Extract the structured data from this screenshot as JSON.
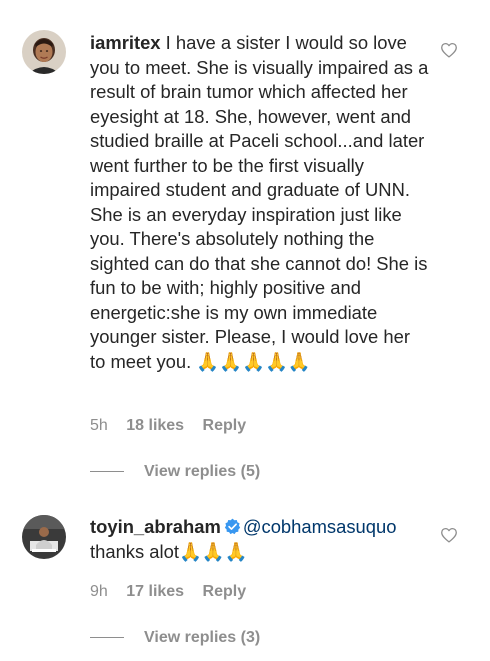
{
  "comments": [
    {
      "username": "iamritex",
      "text": "I have a sister I would so love you to meet. She is visually impaired as a result of brain tumor which affected her eyesight at 18. She, however, went and studied braille at Paceli school...and later went further to be the first visually impaired student and graduate of UNN. She is an everyday inspiration just like you. There's absolutely nothing the sighted can do that she cannot do! She is fun to be with; highly positive and energetic:she is my own immediate younger sister. Please, I would love her to meet you.",
      "emoji": "🙏🙏🙏🙏🙏",
      "time": "5h",
      "likes": "18 likes",
      "reply_label": "Reply",
      "view_replies": "View replies (5)",
      "avatar_icon": "person-avatar-icon",
      "heart_icon": "heart-outline-icon"
    },
    {
      "username": "toyin_abraham",
      "verified": true,
      "mention": "@cobhamsasuquo",
      "text": "thanks alot",
      "emoji": "🙏🙏🙏",
      "time": "9h",
      "likes": "17 likes",
      "reply_label": "Reply",
      "view_replies": "View replies (3)",
      "avatar_icon": "person-avatar-icon",
      "heart_icon": "heart-outline-icon"
    }
  ],
  "colors": {
    "text": "#262626",
    "meta": "#8e8e8e",
    "mention": "#00376b",
    "verified": "#3897f0"
  }
}
